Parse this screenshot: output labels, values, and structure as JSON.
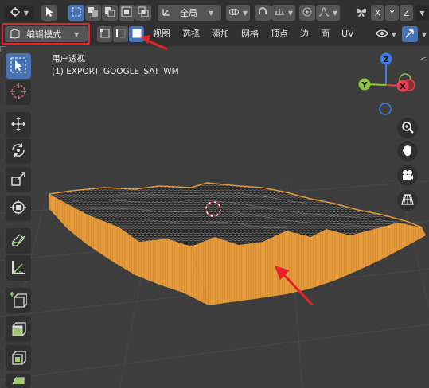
{
  "header": {
    "mode_label": "编辑模式",
    "transform_orientation": "全局",
    "axis_buttons": [
      "X",
      "Y",
      "Z"
    ],
    "menus": [
      "视图",
      "选择",
      "添加",
      "网格",
      "顶点",
      "边",
      "面",
      "UV"
    ]
  },
  "viewport": {
    "view_name": "用户透视",
    "object_name": "(1) EXPORT_GOOGLE_SAT_WM",
    "gizmo_axes": [
      "X",
      "Y",
      "Z"
    ]
  },
  "annotations": {
    "color": "#e8202a"
  },
  "colors": {
    "accent": "#4772b3",
    "mesh_side": "#e59a3a",
    "gizmo_x": "#e8404e",
    "gizmo_y": "#8cc63f",
    "gizmo_z": "#3a7ee2"
  }
}
